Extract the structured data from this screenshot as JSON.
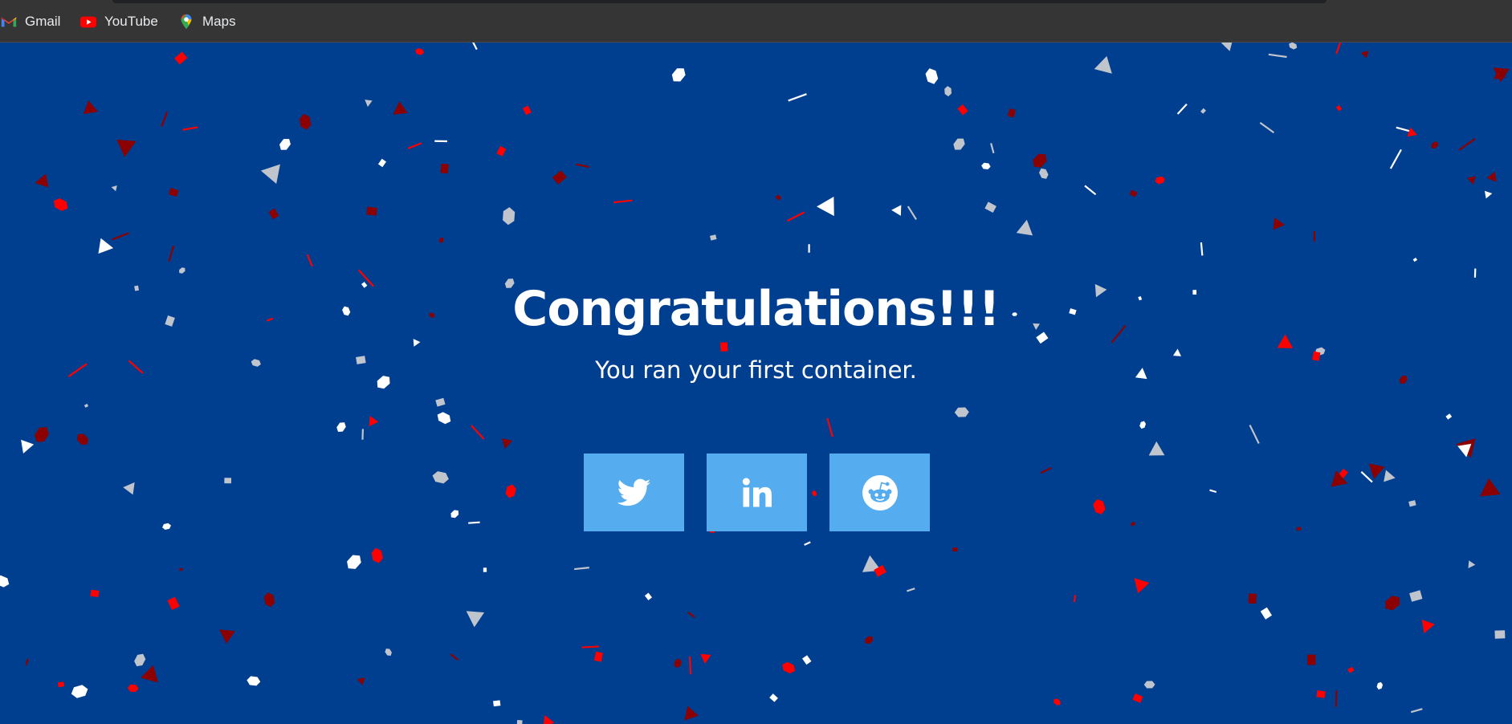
{
  "bookmarks_bar": {
    "items": [
      {
        "label": "Gmail",
        "icon": "gmail-icon"
      },
      {
        "label": "YouTube",
        "icon": "youtube-icon"
      },
      {
        "label": "Maps",
        "icon": "maps-icon"
      }
    ]
  },
  "main": {
    "title": "Congratulations!!!",
    "subtitle": "You ran your first container."
  },
  "share_buttons": [
    {
      "icon": "twitter-icon"
    },
    {
      "icon": "linkedin-icon"
    },
    {
      "icon": "reddit-icon"
    }
  ],
  "colors": {
    "page_background": "#003f8f",
    "share_button": "#55acee",
    "text": "#ffffff",
    "confetti": [
      "#ff0000",
      "#8b0000",
      "#ffffff",
      "#c0c4cc"
    ]
  }
}
